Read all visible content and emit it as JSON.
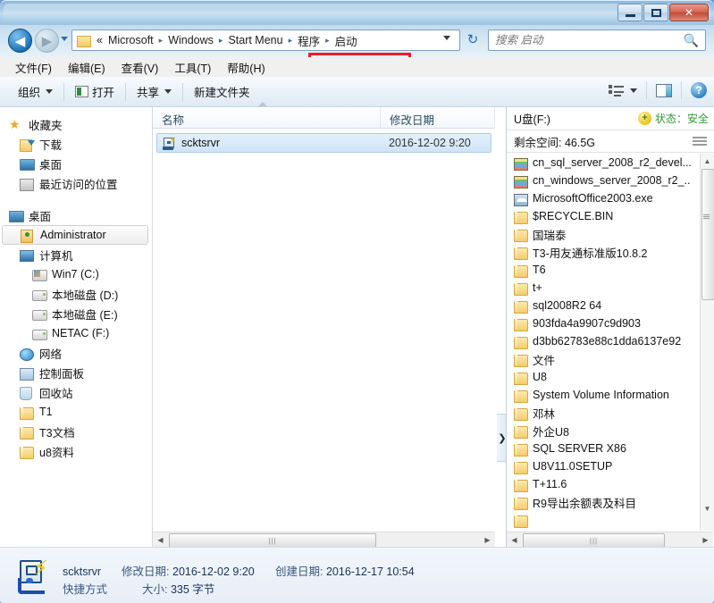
{
  "window": {
    "title": "",
    "controls": {
      "minimize": "minimize-button",
      "maximize": "maximize-button",
      "close": "✕"
    }
  },
  "address_bar": {
    "back_glyph": "◀",
    "forward_glyph": "▶",
    "breadcrumbs": [
      {
        "label": "«",
        "highlighted": false
      },
      {
        "label": "Microsoft",
        "highlighted": false
      },
      {
        "label": "Windows",
        "highlighted": false
      },
      {
        "label": "Start Menu",
        "highlighted": false
      },
      {
        "label": "程序",
        "highlighted": true
      },
      {
        "label": "启动",
        "highlighted": true
      }
    ],
    "separator": "▸",
    "refresh_glyph": "↻"
  },
  "search": {
    "placeholder": "搜索 启动",
    "value": "",
    "icon": "search-icon"
  },
  "menubar": {
    "items": [
      "文件(F)",
      "编辑(E)",
      "查看(V)",
      "工具(T)",
      "帮助(H)"
    ]
  },
  "toolbar": {
    "organize": "组织",
    "open": "打开",
    "share": "共享",
    "new_folder": "新建文件夹",
    "views_icon": "views-icon",
    "preview_icon": "preview-pane-icon",
    "help_icon": "?"
  },
  "nav_pane": {
    "groups": [
      {
        "header": {
          "label": "收藏夹",
          "icon": "star-icon"
        },
        "items": [
          {
            "label": "下载",
            "icon": "downloads-icon",
            "level": 1
          },
          {
            "label": "桌面",
            "icon": "desktop-icon",
            "level": 1
          },
          {
            "label": "最近访问的位置",
            "icon": "recent-places-icon",
            "level": 1
          }
        ]
      },
      {
        "header": {
          "label": "桌面",
          "icon": "desktop-icon"
        },
        "items": [
          {
            "label": "Administrator",
            "icon": "user-folder-icon",
            "level": 1,
            "selected": true
          },
          {
            "label": "计算机",
            "icon": "computer-icon",
            "level": 1
          },
          {
            "label": "Win7 (C:)",
            "icon": "windows-drive-icon",
            "level": 2
          },
          {
            "label": "本地磁盘 (D:)",
            "icon": "drive-icon",
            "level": 2
          },
          {
            "label": "本地磁盘 (E:)",
            "icon": "drive-icon",
            "level": 2
          },
          {
            "label": "NETAC (F:)",
            "icon": "drive-icon",
            "level": 2
          },
          {
            "label": "网络",
            "icon": "network-icon",
            "level": 1
          },
          {
            "label": "控制面板",
            "icon": "control-panel-icon",
            "level": 1
          },
          {
            "label": "回收站",
            "icon": "recycle-bin-icon",
            "level": 1
          },
          {
            "label": "T1",
            "icon": "folder-icon",
            "level": 1
          },
          {
            "label": "T3文档",
            "icon": "folder-icon",
            "level": 1
          },
          {
            "label": "u8资料",
            "icon": "folder-icon",
            "level": 1
          }
        ]
      }
    ]
  },
  "file_pane": {
    "columns": [
      {
        "label": "名称",
        "key": "name"
      },
      {
        "label": "修改日期",
        "key": "date"
      }
    ],
    "rows": [
      {
        "name": "scktsrvr",
        "date": "2016-12-02 9:20",
        "icon": "shortcut-icon",
        "selected": true
      }
    ],
    "hscroll": {
      "left_arrow": "◀",
      "right_arrow": "▶",
      "grip": "|||"
    }
  },
  "expander": {
    "glyph": "❯",
    "name": "preview-pane-expander"
  },
  "drive_pane": {
    "title": "U盘(F:)",
    "status_label": "状态：安全",
    "status_badge": "+",
    "free_space": "剩余空间: 46.5G",
    "menu_icon": "hamburger-menu-icon",
    "items": [
      {
        "label": "cn_sql_server_2008_r2_devel...",
        "icon": "iso-icon"
      },
      {
        "label": "cn_windows_server_2008_r2_..",
        "icon": "iso-icon"
      },
      {
        "label": "MicrosoftOffice2003.exe",
        "icon": "exe-icon"
      },
      {
        "label": "$RECYCLE.BIN",
        "icon": "folder-icon"
      },
      {
        "label": "国瑞泰",
        "icon": "folder-icon"
      },
      {
        "label": "T3-用友通标准版10.8.2",
        "icon": "folder-icon"
      },
      {
        "label": "T6",
        "icon": "folder-icon"
      },
      {
        "label": "t+",
        "icon": "folder-icon"
      },
      {
        "label": "sql2008R2 64",
        "icon": "folder-icon"
      },
      {
        "label": "903fda4a9907c9d903",
        "icon": "folder-icon"
      },
      {
        "label": "d3bb62783e88c1dda6137e92",
        "icon": "folder-icon"
      },
      {
        "label": "文件",
        "icon": "folder-icon"
      },
      {
        "label": "U8",
        "icon": "folder-icon"
      },
      {
        "label": "System Volume Information",
        "icon": "folder-icon"
      },
      {
        "label": "邓林",
        "icon": "folder-icon"
      },
      {
        "label": "外企U8",
        "icon": "folder-icon"
      },
      {
        "label": "SQL SERVER X86",
        "icon": "folder-icon"
      },
      {
        "label": "U8V11.0SETUP",
        "icon": "folder-icon"
      },
      {
        "label": "T+11.6",
        "icon": "folder-icon"
      },
      {
        "label": "R9导出余额表及科目",
        "icon": "folder-icon"
      }
    ],
    "vscroll": {
      "up_arrow": "▲",
      "down_arrow": "▼"
    },
    "hscroll": {
      "left_arrow": "◀",
      "right_arrow": "▶",
      "grip": "|||"
    }
  },
  "status_bar": {
    "icon": "shortcut-large-icon",
    "file_name": "scktsrvr",
    "modified_label": "修改日期:",
    "modified_value": "2016-12-02 9:20",
    "type_label": "快捷方式",
    "size_label": "大小:",
    "size_value": "335 字节",
    "created_label": "创建日期:",
    "created_value": "2016-12-17 10:54"
  },
  "colors": {
    "accent": "#2f6ea5",
    "highlight_box": "#f31c1c",
    "selection": "#cfe4f7",
    "status_safe": "#2f9b2f"
  }
}
